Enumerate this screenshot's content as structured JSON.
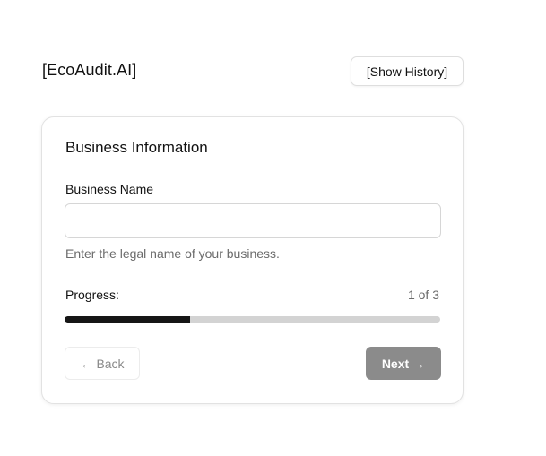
{
  "header": {
    "brand": "[EcoAudit.AI]",
    "history_button": "[Show History]"
  },
  "form": {
    "title": "Business Information",
    "business_name": {
      "label": "Business Name",
      "value": "",
      "placeholder": "",
      "helper": "Enter the legal name of your business."
    },
    "progress": {
      "label": "Progress:",
      "count_text": "1 of 3",
      "current_step": 1,
      "total_steps": 3,
      "fraction": 0.333
    },
    "back_button": {
      "arrow_icon": "arrow-left-icon",
      "label": "Back"
    },
    "next_button": {
      "label": "Next",
      "arrow_icon": "arrow-right-icon"
    }
  },
  "colors": {
    "progress_fill": "#161616",
    "progress_track": "#d3d3d3",
    "next_button_bg": "#8b8b8b",
    "helper_text": "#6b6b6b"
  }
}
